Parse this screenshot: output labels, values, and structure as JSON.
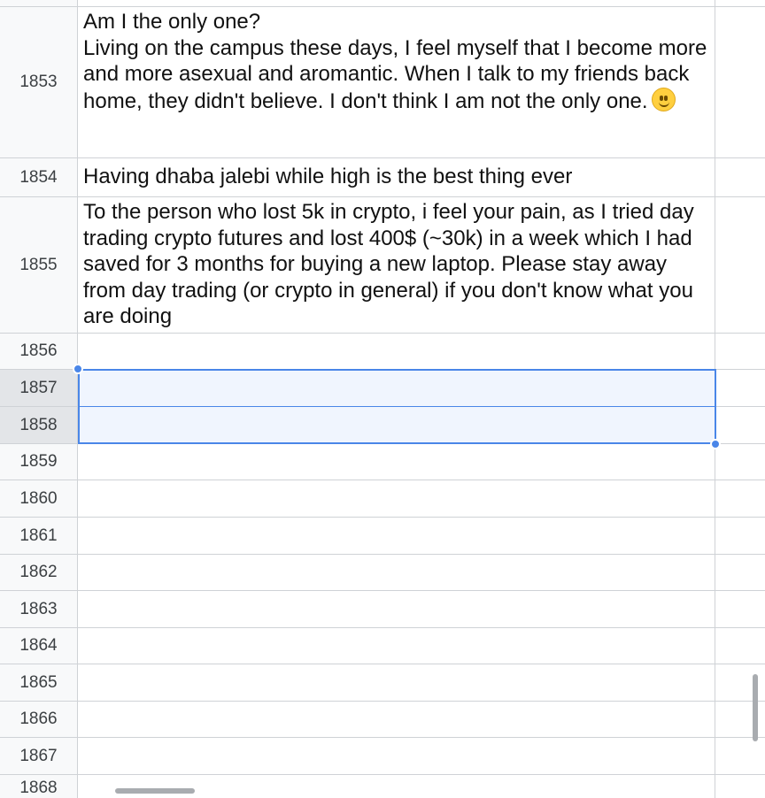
{
  "sheet": {
    "rows": [
      {
        "num": "1853",
        "text": "Am I the only one?\nLiving on the campus these days, I feel myself that I become more and more asexual and aromantic. When I talk to my friends back home, they didn't believe. I don't think I am not the only one.",
        "emoji": "slightly-smiling-face"
      },
      {
        "num": "1854",
        "text": "Having dhaba jalebi while high is the best thing ever"
      },
      {
        "num": "1855",
        "text": "To the person who lost 5k in crypto, i feel your pain, as I tried day trading crypto futures and lost 400$ (~30k) in a week which I had saved for 3 months for buying a new laptop. Please stay away from day trading (or crypto in general) if you don't know what you are doing"
      },
      {
        "num": "1856",
        "text": ""
      },
      {
        "num": "1857",
        "text": ""
      },
      {
        "num": "1858",
        "text": ""
      },
      {
        "num": "1859",
        "text": ""
      },
      {
        "num": "1860",
        "text": ""
      },
      {
        "num": "1861",
        "text": ""
      },
      {
        "num": "1862",
        "text": ""
      },
      {
        "num": "1863",
        "text": ""
      },
      {
        "num": "1864",
        "text": ""
      },
      {
        "num": "1865",
        "text": ""
      },
      {
        "num": "1866",
        "text": ""
      },
      {
        "num": "1867",
        "text": ""
      },
      {
        "num": "1868",
        "text": ""
      }
    ],
    "selected_rows": [
      "1857",
      "1858"
    ],
    "selection_color": "#4a86e8"
  }
}
